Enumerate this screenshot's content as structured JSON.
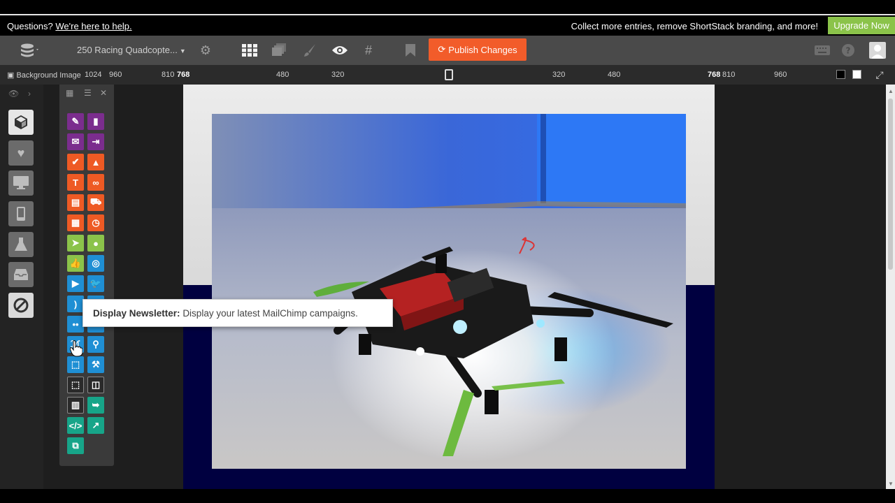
{
  "help_bar": {
    "question": "Questions?",
    "help_link": "We're here to help.",
    "promo": "Collect more entries, remove ShortStack branding, and more!",
    "upgrade": "Upgrade Now"
  },
  "toolbar": {
    "campaign_title": "250 Racing Quadcopte...",
    "publish_label": "Publish Changes",
    "publish_color": "#f25c2a"
  },
  "ruler": {
    "label": "Background Image",
    "ticks_left": [
      "1024",
      "960",
      "810",
      "768",
      "480",
      "320"
    ],
    "ticks_right": [
      "320",
      "480",
      "768",
      "810",
      "960"
    ]
  },
  "tooltip": {
    "title": "Display Newsletter:",
    "text": "Display your latest MailChimp campaigns."
  },
  "colors": {
    "accent_orange": "#ee5a24",
    "upgrade_green": "#8bc34a",
    "widget_purple": "#7b2d8e",
    "widget_blue": "#1f8fd4",
    "widget_teal": "#17a589",
    "page_navy": "#000040"
  }
}
